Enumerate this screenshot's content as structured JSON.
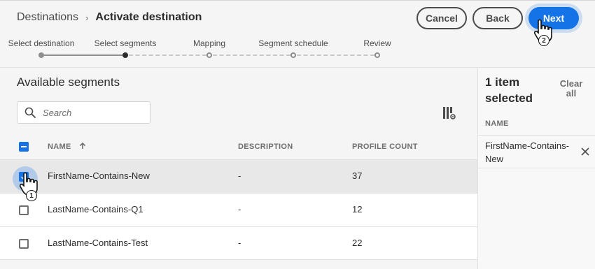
{
  "header": {
    "breadcrumb_root": "Destinations",
    "breadcrumb_separator": "›",
    "breadcrumb_current": "Activate destination",
    "cancel_label": "Cancel",
    "back_label": "Back",
    "next_label": "Next"
  },
  "steps": [
    {
      "label": "Select destination",
      "state": "done"
    },
    {
      "label": "Select segments",
      "state": "current"
    },
    {
      "label": "Mapping",
      "state": "todo"
    },
    {
      "label": "Segment schedule",
      "state": "todo"
    },
    {
      "label": "Review",
      "state": "todo"
    }
  ],
  "main": {
    "title": "Available segments",
    "search_placeholder": "Search",
    "columns": {
      "name": "NAME",
      "description": "DESCRIPTION",
      "profile_count": "PROFILE COUNT"
    },
    "sort_icon": "arrow-up-icon",
    "rows": [
      {
        "name": "FirstName-Contains-New",
        "description": "-",
        "profile_count": "37",
        "checked": true
      },
      {
        "name": "LastName-Contains-Q1",
        "description": "-",
        "profile_count": "12",
        "checked": false
      },
      {
        "name": "LastName-Contains-Test",
        "description": "-",
        "profile_count": "22",
        "checked": false
      }
    ]
  },
  "side": {
    "title": "1 item selected",
    "clear_all": "Clear all",
    "column_header": "NAME",
    "selected_items": [
      "FirstName-Contains-New"
    ]
  },
  "annotations": {
    "marker_1": "1",
    "marker_2": "2"
  },
  "colors": {
    "accent": "#1473e6",
    "text": "#2c2c2c",
    "muted": "#6e6e6e"
  }
}
